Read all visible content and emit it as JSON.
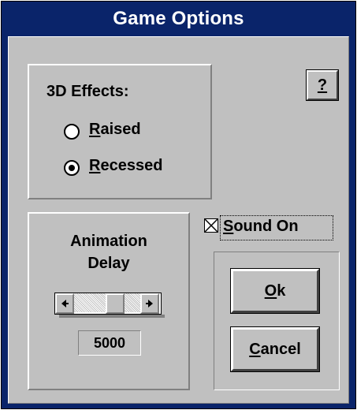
{
  "window": {
    "title": "Game Options"
  },
  "help_button": {
    "label": "?"
  },
  "effects": {
    "heading": "3D Effects:",
    "options": [
      {
        "label_rest": "aised",
        "label_access": "R",
        "selected": false
      },
      {
        "label_rest": "ecessed",
        "label_access": "R",
        "selected": true
      }
    ]
  },
  "animation": {
    "heading_line1": "Animation",
    "heading_line2": "Delay",
    "value": "5000"
  },
  "sound": {
    "label_access": "S",
    "label_rest": "ound On",
    "checked": true
  },
  "buttons": {
    "ok_access": "O",
    "ok_rest": "k",
    "cancel_access": "C",
    "cancel_rest": "ancel"
  },
  "colors": {
    "titlebar": "#0a246a",
    "face": "#c0c0c0"
  }
}
